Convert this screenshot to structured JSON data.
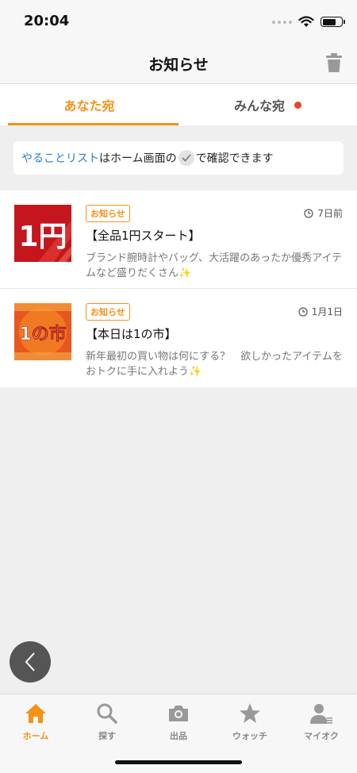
{
  "status": {
    "time": "20:04"
  },
  "header": {
    "title": "お知らせ"
  },
  "tabs": [
    {
      "label": "あなた宛",
      "active": true
    },
    {
      "label": "みんな宛",
      "active": false,
      "has_dot": true
    }
  ],
  "todo_banner": {
    "link_text": "やることリスト",
    "text_before_icon": "はホーム画面の",
    "text_after_icon": "で確認できます"
  },
  "notices": [
    {
      "thumb_text": "1円",
      "badge": "お知らせ",
      "date": "7日前",
      "title": "【全品1円スタート】",
      "description": "ブランド腕時計やバッグ、大活躍のあったか優秀アイテムなど盛りだくさん✨"
    },
    {
      "thumb_text": "1の市",
      "badge": "お知らせ",
      "date": "1月1日",
      "title": "【本日は1の市】",
      "description": "新年最初の買い物は何にする？　欲しかったアイテムをおトクに手に入れよう✨"
    }
  ],
  "bottom_nav": [
    {
      "label": "ホーム",
      "icon": "home-icon",
      "active": true
    },
    {
      "label": "探す",
      "icon": "search-icon",
      "active": false
    },
    {
      "label": "出品",
      "icon": "camera-icon",
      "active": false
    },
    {
      "label": "ウォッチ",
      "icon": "star-icon",
      "active": false
    },
    {
      "label": "マイオク",
      "icon": "user-icon",
      "active": false
    }
  ],
  "colors": {
    "accent": "#f39218",
    "link": "#2a7ecf",
    "dot": "#e8452a"
  }
}
